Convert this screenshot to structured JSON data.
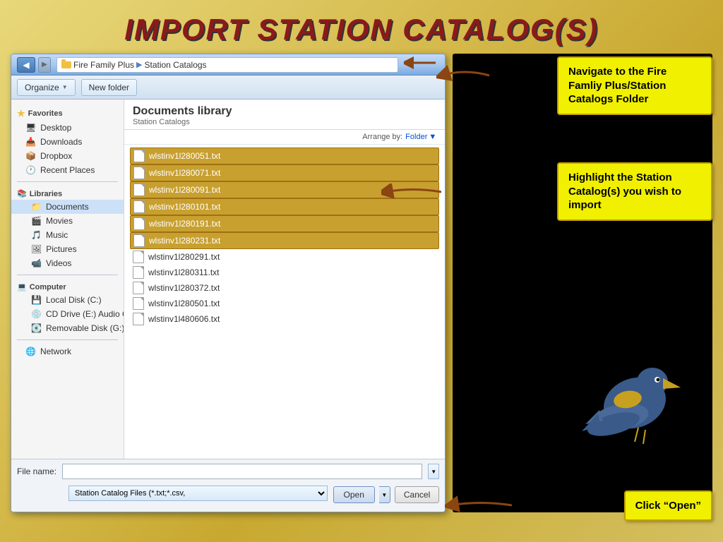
{
  "title": "IMPORT STATION CATALOG(S)",
  "callouts": {
    "c1": "Navigate to the Fire Famliy Plus/Station Catalogs Folder",
    "c2": "Highlight the Station Catalog(s) you wish to import",
    "c3": "Click “Open”"
  },
  "dialog": {
    "breadcrumb": {
      "parts": [
        "Fire Family Plus",
        "Station Catalogs"
      ]
    },
    "toolbar": {
      "organize": "Organize",
      "new_folder": "New folder"
    },
    "sidebar": {
      "favorites_header": "Favorites",
      "items_favorites": [
        {
          "label": "Desktop",
          "icon": "desktop-icon"
        },
        {
          "label": "Downloads",
          "icon": "downloads-icon"
        },
        {
          "label": "Dropbox",
          "icon": "dropbox-icon"
        },
        {
          "label": "Recent Places",
          "icon": "recent-icon"
        }
      ],
      "libraries_header": "Libraries",
      "items_libraries": [
        {
          "label": "Documents",
          "icon": "documents-icon",
          "active": true
        },
        {
          "label": "Movies",
          "icon": "movies-icon"
        },
        {
          "label": "Music",
          "icon": "music-icon"
        },
        {
          "label": "Pictures",
          "icon": "pictures-icon"
        },
        {
          "label": "Videos",
          "icon": "videos-icon"
        }
      ],
      "computer_header": "Computer",
      "items_computer": [
        {
          "label": "Local Disk (C:)",
          "icon": "disk-icon"
        },
        {
          "label": "CD Drive (E:) Audio CD",
          "icon": "cd-icon"
        },
        {
          "label": "Removable Disk (G:)",
          "icon": "removable-icon"
        }
      ],
      "network_header": "Network",
      "items_network": [
        {
          "label": "Network",
          "icon": "network-icon"
        }
      ]
    },
    "file_list": {
      "library_title": "Documents library",
      "library_subtitle": "Station Catalogs",
      "arrange_by_label": "Arrange by:",
      "arrange_by_value": "Folder",
      "files_selected": [
        "wlstinv1l280051.txt",
        "wlstinv1l280071.txt",
        "wlstinv1l280091.txt",
        "wlstinv1l280101.txt",
        "wlstinv1l280191.txt",
        "wlstinv1l280231.txt"
      ],
      "files_normal": [
        "wlstinv1l280291.txt",
        "wlstinv1l280311.txt",
        "wlstinv1l280372.txt",
        "wlstinv1l280501.txt",
        "wlstinv1l480606.txt"
      ]
    },
    "bottom": {
      "filename_label": "File name:",
      "filetype_value": "Station Catalog Files (*.txt;*.csv,",
      "btn_open": "Open",
      "btn_cancel": "Cancel"
    }
  }
}
